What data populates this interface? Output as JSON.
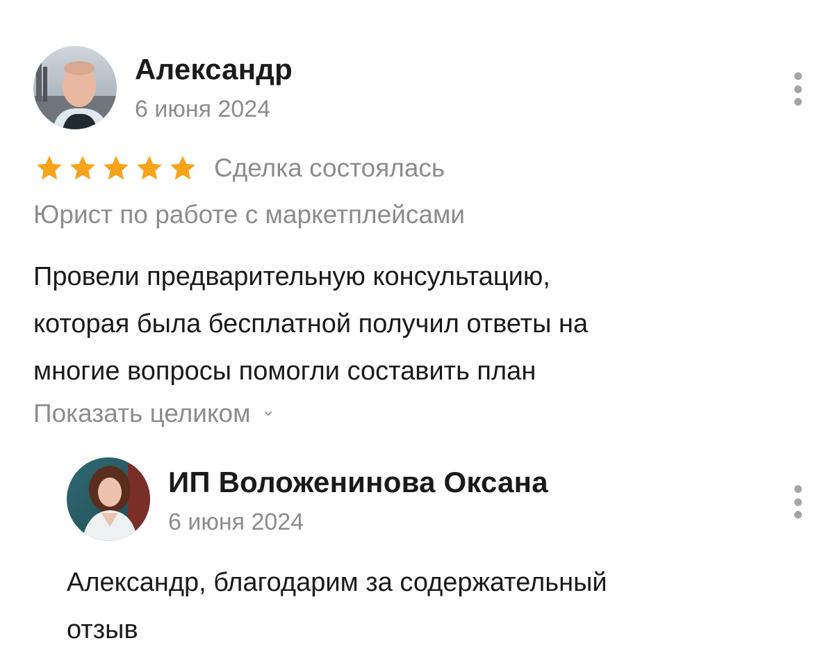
{
  "review": {
    "author": "Александр",
    "date": "6 июня 2024",
    "rating": 5,
    "rating_max": 5,
    "star_color": "#f7a41d",
    "deal_status": "Сделка состоялась",
    "service": "Юрист по работе с маркетплейсами",
    "text_lines": [
      "Провели предварительную консультацию,",
      "которая была бесплатной получил ответы на",
      "многие вопросы помогли составить план"
    ],
    "show_full_label": "Показать целиком",
    "show_full_icon": "chevron-down-icon",
    "menu_icon": "more-vertical-icon"
  },
  "reply": {
    "author": "ИП Воложенинова Оксана",
    "date": "6 июня 2024",
    "text_lines": [
      "Александр, благодарим за содержательный",
      "отзыв"
    ],
    "menu_icon": "more-vertical-icon"
  },
  "colors": {
    "primary_text": "#1a1a1a",
    "secondary_text": "#8c8c8c",
    "star": "#f7a41d",
    "menu_dots": "#a6a6a6"
  }
}
